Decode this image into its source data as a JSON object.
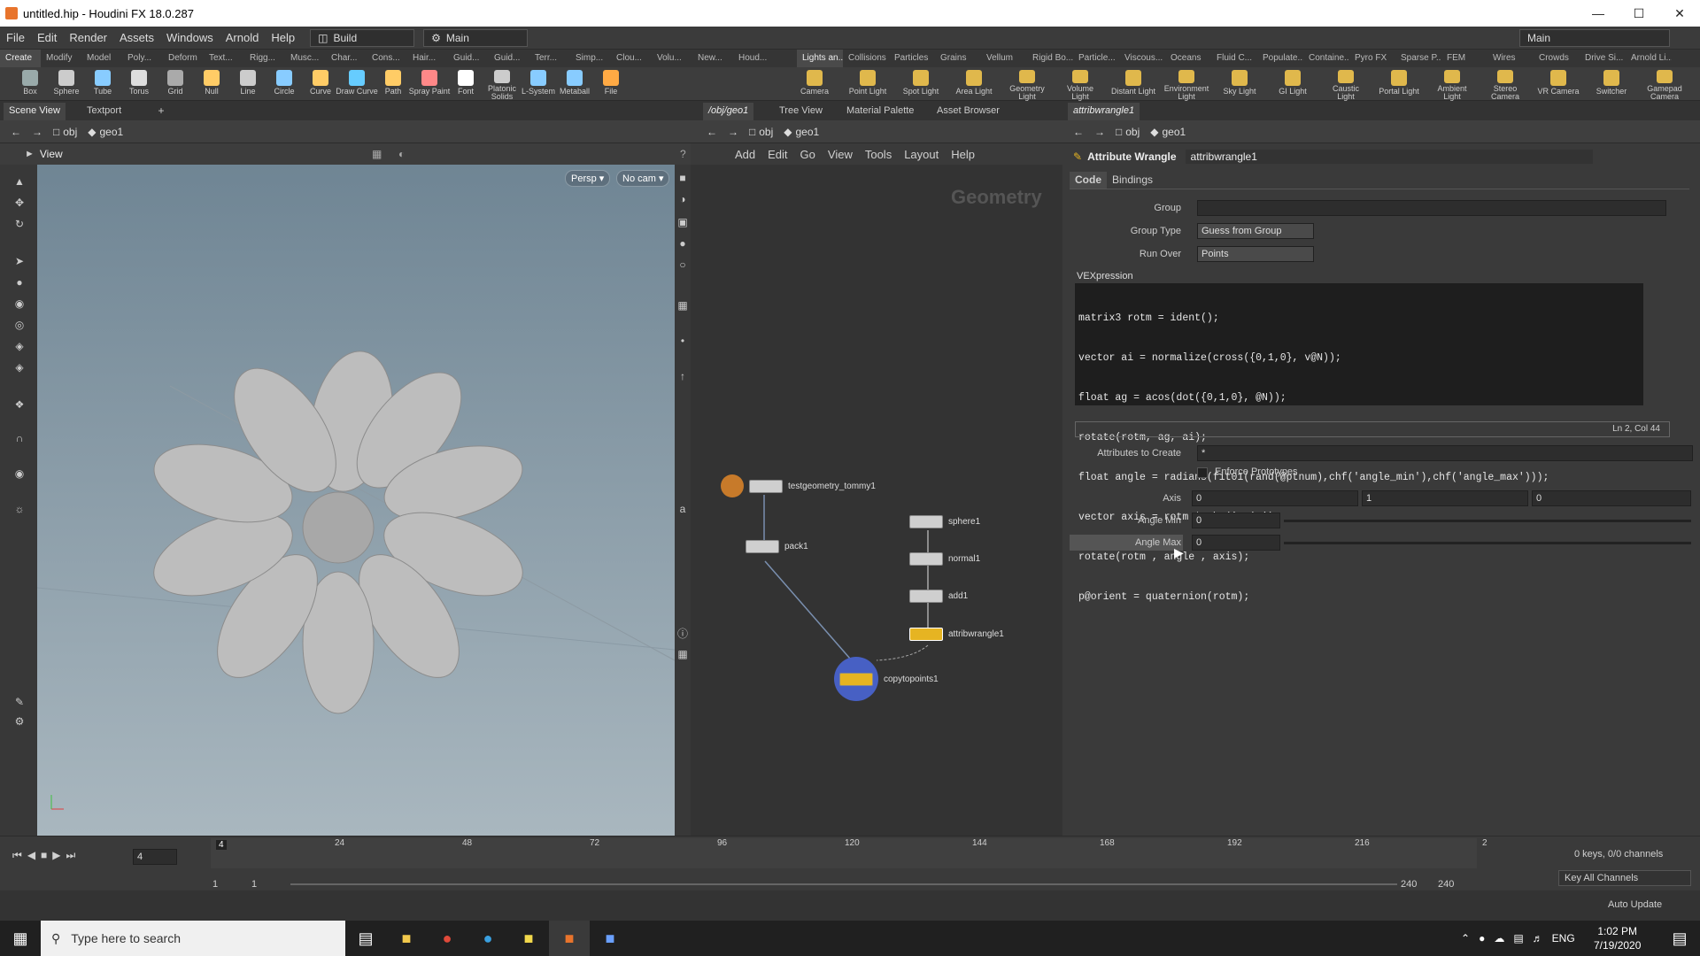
{
  "window": {
    "title": "untitled.hip - Houdini FX 18.0.287"
  },
  "menu": {
    "items": [
      "File",
      "Edit",
      "Render",
      "Assets",
      "Windows",
      "Arnold",
      "Help"
    ],
    "desktop": "Build",
    "runset": "Main",
    "right_desktop": "Main"
  },
  "shelf_tabs_left": [
    "Create",
    "Modify",
    "Model",
    "Poly...",
    "Deform",
    "Text...",
    "Rigg...",
    "Musc...",
    "Char...",
    "Cons...",
    "Hair...",
    "Guid...",
    "Guid...",
    "Terr...",
    "Simp...",
    "Clou...",
    "Volu...",
    "New...",
    "Houd..."
  ],
  "shelf_tabs_right": [
    "Lights an...",
    "Collisions",
    "Particles",
    "Grains",
    "Vellum",
    "Rigid Bo...",
    "Particle...",
    "Viscous...",
    "Oceans",
    "Fluid C...",
    "Populate...",
    "Containe...",
    "Pyro FX",
    "Sparse P...",
    "FEM",
    "Wires",
    "Crowds",
    "Drive Si...",
    "Arnold Li..."
  ],
  "tools_left": [
    "Box",
    "Sphere",
    "Tube",
    "Torus",
    "Grid",
    "Null",
    "Line",
    "Circle",
    "Curve",
    "Draw Curve",
    "Path",
    "Spray Paint",
    "Font",
    "Platonic Solids",
    "L-System",
    "Metaball",
    "File"
  ],
  "tools_right": [
    "Camera",
    "Point Light",
    "Spot Light",
    "Area Light",
    "Geometry Light",
    "Volume Light",
    "Distant Light",
    "Environment Light",
    "Sky Light",
    "GI Light",
    "Caustic Light",
    "Portal Light",
    "Ambient Light",
    "Stereo Camera",
    "VR Camera",
    "Switcher",
    "Gamepad Camera"
  ],
  "left_panel": {
    "tabs": [
      "Scene View",
      "Textport"
    ],
    "path": [
      "obj",
      "geo1"
    ],
    "view_label": "View",
    "persp": "Persp",
    "cam": "No cam"
  },
  "mid_panel": {
    "tabs": [
      "/obj/geo1",
      "Tree View",
      "Material Palette",
      "Asset Browser"
    ],
    "path": [
      "obj",
      "geo1"
    ],
    "menu": [
      "Add",
      "Edit",
      "Go",
      "View",
      "Tools",
      "Layout",
      "Help"
    ],
    "context_label": "Geometry",
    "nodes": {
      "testgeo": "testgeometry_tommy1",
      "pack": "pack1",
      "sphere": "sphere1",
      "normal": "normal1",
      "add": "add1",
      "wrangle": "attribwrangle1",
      "copy": "copytopoints1"
    }
  },
  "right_panel": {
    "tab": "attribwrangle1",
    "path": [
      "obj",
      "geo1"
    ],
    "node_type": "Attribute Wrangle",
    "node_name": "attribwrangle1",
    "subtabs": [
      "Code",
      "Bindings"
    ],
    "group_label": "Group",
    "group_value": "",
    "group_type_label": "Group Type",
    "group_type_value": "Guess from Group",
    "run_over_label": "Run Over",
    "run_over_value": "Points",
    "vex_label": "VEXpression",
    "code_lines": [
      "matrix3 rotm = ident();",
      "vector ai = normalize(cross({0,1,0}, v@N));",
      "float ag = acos(dot({0,1,0}, @N));",
      "rotate(rotm, ag, ai);",
      "float angle = radians(fit01(rand(@ptnum),chf('angle_min'),chf('angle_max')));",
      "vector axis = rotm * chv('axis');",
      "rotate(rotm , angle , axis);",
      "p@orient = quaternion(rotm);"
    ],
    "cursor_pos": "Ln 2, Col 44",
    "attrs_label": "Attributes to Create",
    "attrs_value": "*",
    "enforce_label": "Enforce Prototypes",
    "axis_label": "Axis",
    "axis_values": [
      "0",
      "1",
      "0"
    ],
    "angle_min_label": "Angle Min",
    "angle_min_value": "0",
    "angle_max_label": "Angle Max",
    "angle_max_value": "0"
  },
  "timeline": {
    "frame": "4",
    "marker": "4",
    "ticks": [
      "24",
      "48",
      "72",
      "96",
      "120",
      "144",
      "168",
      "192",
      "216",
      "2"
    ],
    "start": "1",
    "start2": "1",
    "end": "240",
    "end2": "240",
    "keys": "0 keys, 0/0 channels",
    "key_all": "Key All Channels"
  },
  "status": {
    "auto_update": "Auto Update"
  },
  "taskbar": {
    "search": "Type here to search",
    "lang": "ENG",
    "time": "1:02 PM",
    "date": "7/19/2020"
  }
}
